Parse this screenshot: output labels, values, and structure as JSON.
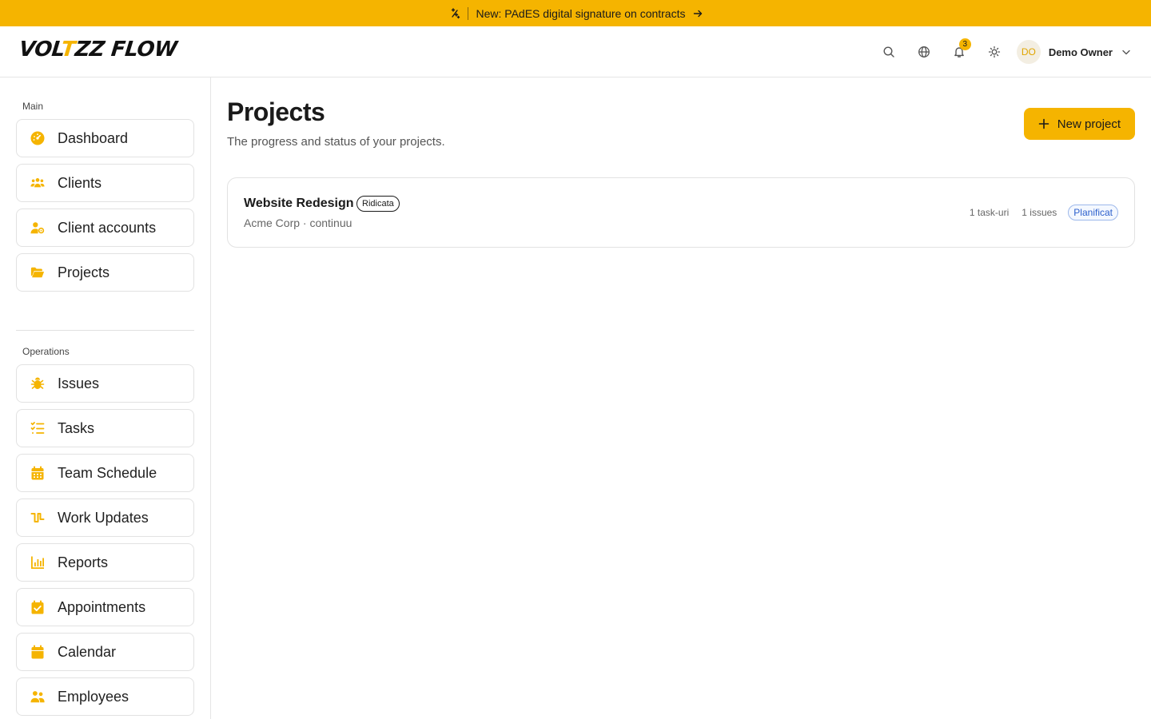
{
  "announcement": {
    "text": "New: PAdES digital signature on contracts"
  },
  "brand": {
    "logo_pre": "VOL",
    "logo_t": "T",
    "logo_post": "ZZ FLOW",
    "accent": "#f5b400"
  },
  "topbar": {
    "notifications_count": "3",
    "user": {
      "initials": "DO",
      "name": "Demo Owner"
    }
  },
  "sidebar": {
    "main_label": "Main",
    "operations_label": "Operations",
    "main_items": [
      {
        "label": "Dashboard",
        "icon": "gauge-icon"
      },
      {
        "label": "Clients",
        "icon": "users-icon"
      },
      {
        "label": "Client accounts",
        "icon": "user-gear-icon"
      },
      {
        "label": "Projects",
        "icon": "folder-open-icon"
      }
    ],
    "ops_items": [
      {
        "label": "Issues",
        "icon": "bug-icon"
      },
      {
        "label": "Tasks",
        "icon": "list-check-icon"
      },
      {
        "label": "Team Schedule",
        "icon": "calendar-grid-icon"
      },
      {
        "label": "Work Updates",
        "icon": "pulse-icon"
      },
      {
        "label": "Reports",
        "icon": "bar-chart-icon"
      },
      {
        "label": "Appointments",
        "icon": "calendar-check-icon"
      },
      {
        "label": "Calendar",
        "icon": "calendar-icon"
      },
      {
        "label": "Employees",
        "icon": "user-group-icon"
      }
    ]
  },
  "main": {
    "title": "Projects",
    "subtitle": "The progress and status of your projects.",
    "new_button": "New project",
    "projects": [
      {
        "name": "Website Redesign",
        "priority": "Ridicata",
        "meta": "Acme Corp · continuu",
        "tasks": "1 task-uri",
        "issues": "1 issues",
        "status": "Planificat"
      }
    ]
  }
}
